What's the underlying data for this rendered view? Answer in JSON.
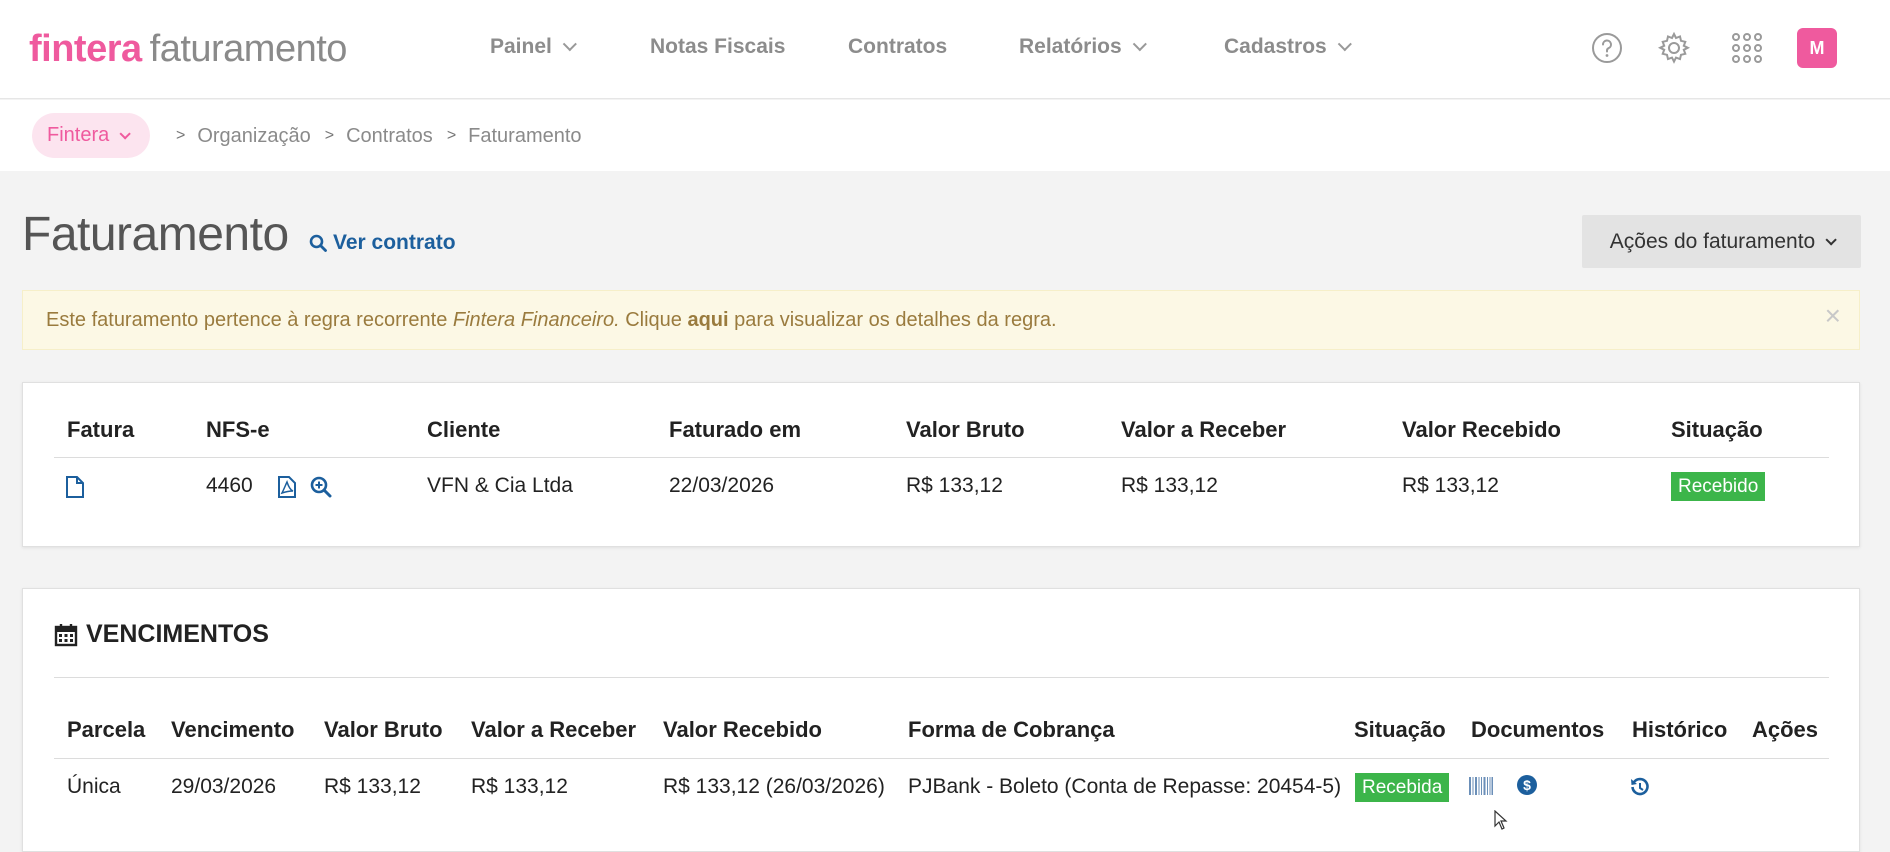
{
  "header": {
    "brand": "fintera",
    "product": "faturamento",
    "nav": [
      {
        "label": "Painel",
        "dropdown": true
      },
      {
        "label": "Notas Fiscais",
        "dropdown": false
      },
      {
        "label": "Contratos",
        "dropdown": false
      },
      {
        "label": "Relatórios",
        "dropdown": true
      },
      {
        "label": "Cadastros",
        "dropdown": true
      }
    ],
    "icons": [
      "help-icon",
      "gear-icon",
      "apps-grid-icon"
    ],
    "avatar_initial": "M"
  },
  "breadcrumb": {
    "org": "Fintera",
    "items": [
      "Organização",
      "Contratos",
      "Faturamento"
    ]
  },
  "page": {
    "title": "Faturamento",
    "view_contract_label": "Ver contrato",
    "actions_label": "Ações do faturamento"
  },
  "alert": {
    "text_before": "Este faturamento pertence à regra recorrente ",
    "rule_name": "Fintera Financeiro.",
    "text_middle": " Clique ",
    "link_text": "aqui",
    "text_after": " para visualizar os detalhes da regra.",
    "close": "×"
  },
  "invoice_table": {
    "headers": [
      "Fatura",
      "NFS-e",
      "Cliente",
      "Faturado em",
      "Valor Bruto",
      "Valor a Receber",
      "Valor Recebido",
      "Situação"
    ],
    "row": {
      "nfse": "4460",
      "cliente": "VFN & Cia Ltda",
      "faturado_em": "22/03/2026",
      "valor_bruto": "R$ 133,12",
      "valor_a_receber": "R$ 133,12",
      "valor_recebido": "R$ 133,12",
      "situacao": "Recebido"
    }
  },
  "vencimentos": {
    "title": "VENCIMENTOS",
    "headers": [
      "Parcela",
      "Vencimento",
      "Valor Bruto",
      "Valor a Receber",
      "Valor Recebido",
      "Forma de Cobrança",
      "Situação",
      "Documentos",
      "Histórico",
      "Ações"
    ],
    "row": {
      "parcela": "Única",
      "vencimento": "29/03/2026",
      "valor_bruto": "R$ 133,12",
      "valor_a_receber": "R$ 133,12",
      "valor_recebido": "R$ 133,12 (26/03/2026)",
      "forma_cobranca": "PJBank - Boleto (Conta de Repasse: 20454-5)",
      "situacao": "Recebida"
    }
  },
  "colors": {
    "brand_pink": "#ef5a9e",
    "link_blue": "#1c5f9d",
    "success_green": "#3cb54a",
    "alert_bg": "#fcf8e5",
    "alert_text": "#9a7b3e"
  }
}
